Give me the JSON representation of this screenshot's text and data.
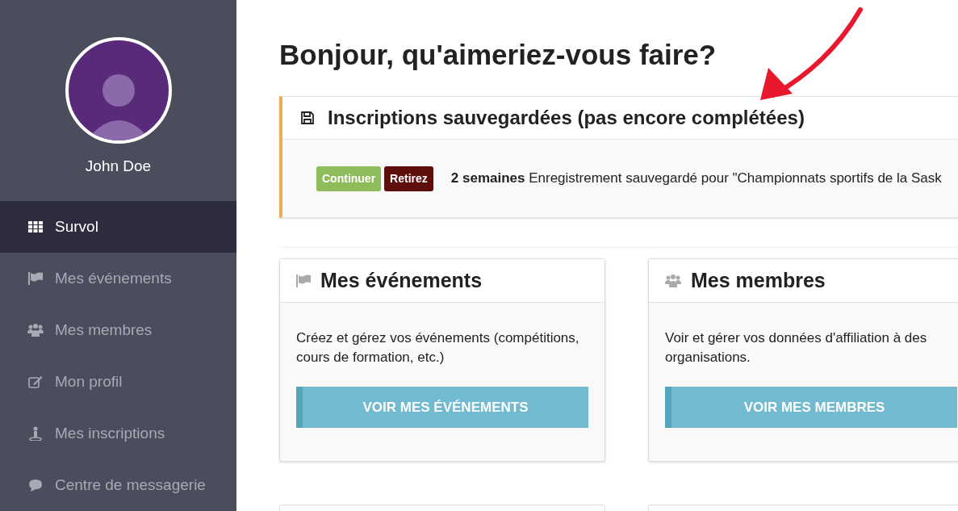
{
  "user": {
    "name": "John Doe"
  },
  "sidebar": {
    "items": [
      {
        "label": "Survol",
        "selected": true
      },
      {
        "label": "Mes événements",
        "selected": false
      },
      {
        "label": "Mes membres",
        "selected": false
      },
      {
        "label": "Mon profil",
        "selected": false
      },
      {
        "label": "Mes inscriptions",
        "selected": false
      },
      {
        "label": "Centre de messagerie",
        "selected": false
      }
    ]
  },
  "heading": "Bonjour, qu'aimeriez-vous faire?",
  "saved_registrations": {
    "title": "Inscriptions sauvegardées (pas encore complétées)",
    "entries": [
      {
        "actions": [
          {
            "label": "Continuer",
            "kind": "continue"
          },
          {
            "label": "Retirez",
            "kind": "remove"
          }
        ],
        "text": "**2 semaines** Enregistrement sauvegardé pour \"Championnats sportifs de la Sask"
      }
    ]
  },
  "cards": [
    {
      "title": "Mes événements",
      "description": "Créez et gérez vos événements (compétitions, cours de formation, etc.)",
      "button": "VOIR MES ÉVÉNEMENTS"
    },
    {
      "title": "Mes membres",
      "description": "Voir et gérer vos données d'affiliation à des organisations.",
      "button": "VOIR MES MEMBRES"
    }
  ]
}
